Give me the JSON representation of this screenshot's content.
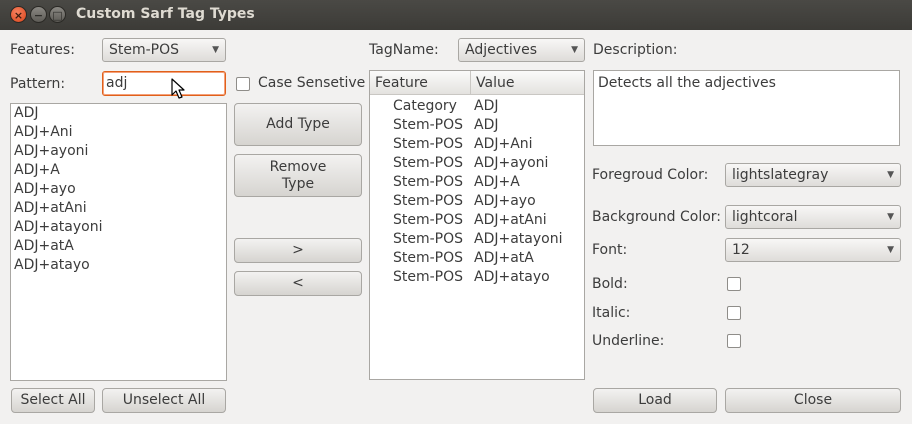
{
  "window": {
    "title": "Custom Sarf Tag Types",
    "close_glyph": "×",
    "min_glyph": "−",
    "max_glyph": "□"
  },
  "left": {
    "features_label": "Features:",
    "features_value": "Stem-POS",
    "pattern_label": "Pattern:",
    "pattern_value": "adj",
    "case_sensitive_label": "Case Sensetive",
    "list_items": [
      "ADJ",
      "ADJ+Ani",
      "ADJ+ayoni",
      "ADJ+A",
      "ADJ+ayo",
      "ADJ+atAni",
      "ADJ+atayoni",
      "ADJ+atA",
      "ADJ+atayo"
    ],
    "select_all": "Select All",
    "unselect_all": "Unselect All"
  },
  "middle": {
    "add_type": "Add Type",
    "remove_type": "Remove Type",
    "move_right": ">",
    "move_left": "<"
  },
  "tag": {
    "tagname_label": "TagName:",
    "tagname_value": "Adjectives",
    "columns": [
      "Feature",
      "Value"
    ],
    "rows": [
      [
        "Category",
        "ADJ"
      ],
      [
        "Stem-POS",
        "ADJ"
      ],
      [
        "Stem-POS",
        "ADJ+Ani"
      ],
      [
        "Stem-POS",
        "ADJ+ayoni"
      ],
      [
        "Stem-POS",
        "ADJ+A"
      ],
      [
        "Stem-POS",
        "ADJ+ayo"
      ],
      [
        "Stem-POS",
        "ADJ+atAni"
      ],
      [
        "Stem-POS",
        "ADJ+atayoni"
      ],
      [
        "Stem-POS",
        "ADJ+atA"
      ],
      [
        "Stem-POS",
        "ADJ+atayo"
      ]
    ]
  },
  "right": {
    "description_label": "Description:",
    "description_value": "Detects all the adjectives",
    "foreground_label": "Foregroud Color:",
    "foreground_value": "lightslategray",
    "background_label": "Background Color:",
    "background_value": "lightcoral",
    "font_label": "Font:",
    "font_value": "12",
    "bold_label": "Bold:",
    "italic_label": "Italic:",
    "underline_label": "Underline:",
    "load": "Load",
    "close": "Close"
  },
  "colors": {
    "titlebar": "#3c3b37",
    "focus_border": "#e0601a",
    "close_button": "#d9441a"
  },
  "icons": {
    "dropdown": "chevron-down-icon",
    "pointer": "mouse-pointer-icon"
  }
}
